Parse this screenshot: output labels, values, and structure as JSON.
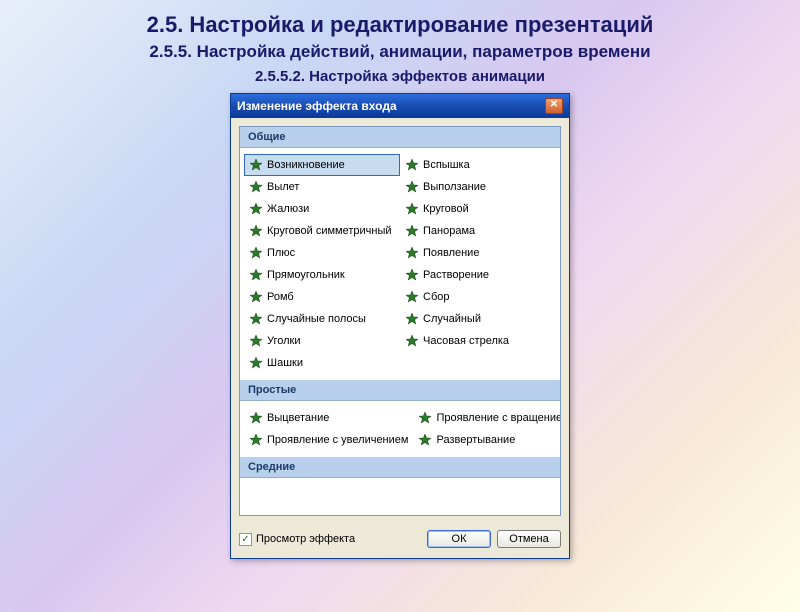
{
  "slide": {
    "title": "2.5. Настройка и редактирование презентаций",
    "sub1": "2.5.5. Настройка действий, анимации, параметров времени",
    "sub2": "2.5.5.2. Настройка эффектов анимации"
  },
  "dialog": {
    "title": "Изменение эффекта входа",
    "close_glyph": "✕",
    "groups": [
      {
        "name": "Общие",
        "effects": [
          {
            "label": "Возникновение",
            "selected": true
          },
          {
            "label": "Вспышка"
          },
          {
            "label": "Вылет"
          },
          {
            "label": "Выползание"
          },
          {
            "label": "Жалюзи"
          },
          {
            "label": "Круговой"
          },
          {
            "label": "Круговой симметричный"
          },
          {
            "label": "Панорама"
          },
          {
            "label": "Плюс"
          },
          {
            "label": "Появление"
          },
          {
            "label": "Прямоугольник"
          },
          {
            "label": "Растворение"
          },
          {
            "label": "Ромб"
          },
          {
            "label": "Сбор"
          },
          {
            "label": "Случайные полосы"
          },
          {
            "label": "Случайный"
          },
          {
            "label": "Уголки"
          },
          {
            "label": "Часовая стрелка"
          },
          {
            "label": "Шашки"
          }
        ]
      },
      {
        "name": "Простые",
        "effects": [
          {
            "label": "Выцветание"
          },
          {
            "label": "Проявление с вращением"
          },
          {
            "label": "Проявление с увеличением"
          },
          {
            "label": "Развертывание"
          }
        ]
      },
      {
        "name": "Средние",
        "effects": []
      }
    ],
    "preview_label": "Просмотр эффекта",
    "preview_checked": true,
    "ok_label": "ОК",
    "cancel_label": "Отмена"
  },
  "icons": {
    "star_green": "#2a7a2a"
  }
}
